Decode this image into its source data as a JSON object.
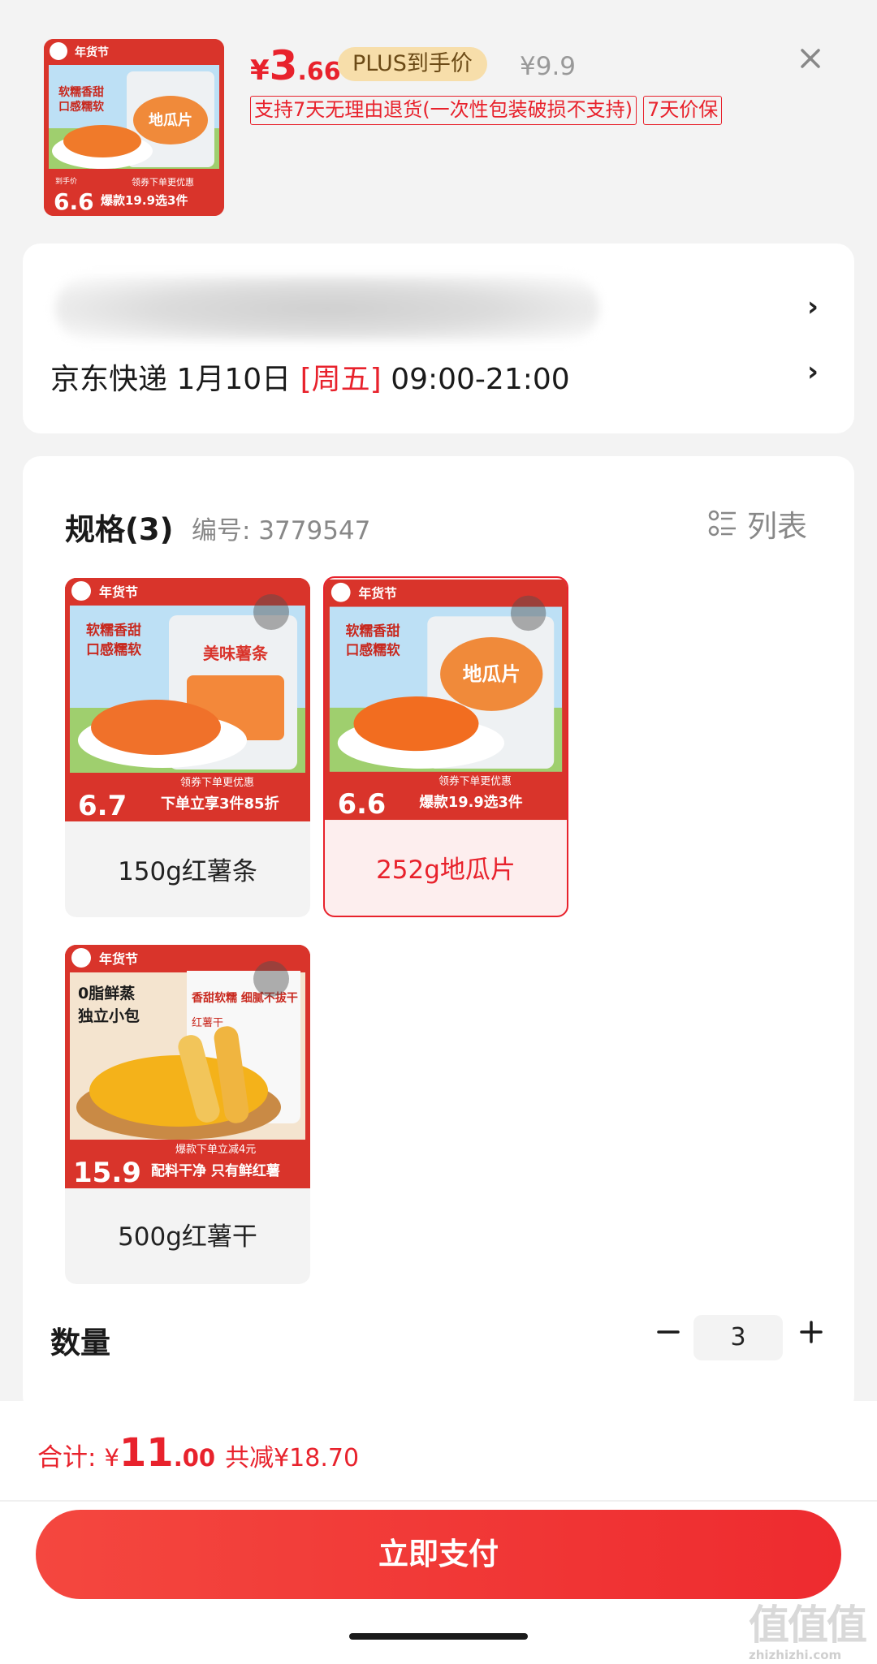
{
  "header": {
    "price_symbol": "¥",
    "price_int": "3",
    "price_dec": ".66",
    "plus_badge": "PLUS到手价",
    "original_price": "¥9.9",
    "tags": [
      "支持7天无理由退货(一次性包装破损不支持)",
      "7天价保"
    ],
    "thumb": {
      "brand_badge": "年货节",
      "slogan1": "软糯香甜",
      "slogan2": "口感糯软",
      "pack_text": "地瓜片",
      "price_label": "到手价",
      "price": "6.6",
      "coupon": "领券下单更优惠",
      "promo": "爆款19.9选3件"
    }
  },
  "address": {
    "delivery_carrier": "京东快递",
    "delivery_date": "1月10日",
    "delivery_weekday": "[周五]",
    "delivery_time": "09:00-21:00"
  },
  "spec": {
    "title": "规格(3)",
    "code": "编号: 3779547",
    "list_toggle": "列表",
    "items": [
      {
        "label": "150g红薯条",
        "selected": false,
        "img": {
          "brand_badge": "年货节",
          "slogan1": "软糯香甜",
          "slogan2": "口感糯软",
          "pack_text": "美味薯条",
          "price": "6.7",
          "coupon": "领券下单更优惠",
          "promo": "下单立享3件85折"
        }
      },
      {
        "label": "252g地瓜片",
        "selected": true,
        "img": {
          "brand_badge": "年货节",
          "slogan1": "软糯香甜",
          "slogan2": "口感糯软",
          "pack_text": "地瓜片",
          "price": "6.6",
          "coupon": "领券下单更优惠",
          "promo": "爆款19.9选3件"
        }
      },
      {
        "label": "500g红薯干",
        "selected": false,
        "img": {
          "brand_badge": "年货节",
          "slogan1": "0脂鲜蒸",
          "slogan2": "独立小包",
          "pack_text": "香甜软糯 细腻不拔干",
          "pack_sub": "红薯干",
          "price": "15.9",
          "coupon": "爆款下单立减4元",
          "promo": "配料干净 只有鲜红薯"
        }
      }
    ],
    "quantity_label": "数量",
    "quantity": "3"
  },
  "footer": {
    "total_label": "合计:",
    "total_symbol": "¥",
    "total_int": "11",
    "total_dec": ".00",
    "total_save": "共减¥18.70",
    "pay_button": "立即支付",
    "watermark": "值值值",
    "watermark_sub": "zhizhizhi.com"
  },
  "colors": {
    "accent": "#e8222c",
    "plus_badge_bg": "#f7deaa",
    "background": "#f3f3f3"
  }
}
